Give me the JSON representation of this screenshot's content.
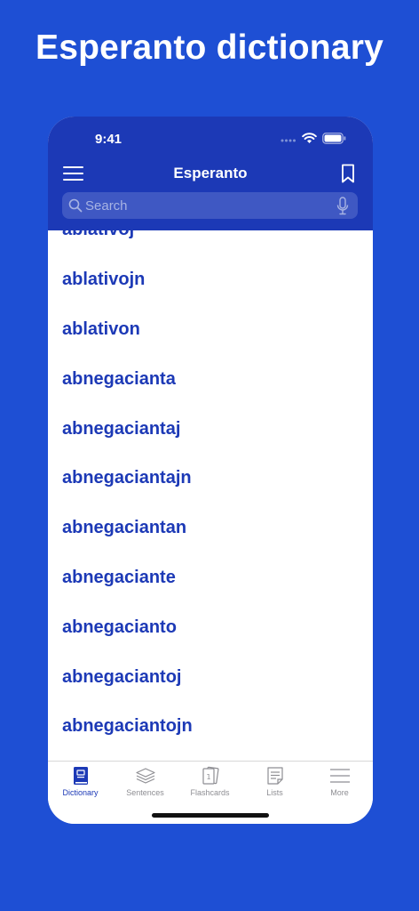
{
  "promo": {
    "title": "Esperanto dictionary"
  },
  "status_bar": {
    "time": "9:41"
  },
  "nav": {
    "title": "Esperanto"
  },
  "search": {
    "placeholder": "Search",
    "value": ""
  },
  "words": [
    "ablativoj",
    "ablativojn",
    "ablativon",
    "abnegacianta",
    "abnegaciantaj",
    "abnegaciantajn",
    "abnegaciantan",
    "abnegaciante",
    "abnegacianto",
    "abnegaciantoj",
    "abnegaciantojn"
  ],
  "tabs": [
    {
      "label": "Dictionary",
      "icon": "dictionary-icon",
      "active": true
    },
    {
      "label": "Sentences",
      "icon": "sentences-icon",
      "active": false
    },
    {
      "label": "Flashcards",
      "icon": "flashcards-icon",
      "active": false
    },
    {
      "label": "Lists",
      "icon": "lists-icon",
      "active": false
    },
    {
      "label": "More",
      "icon": "more-icon",
      "active": false
    }
  ],
  "colors": {
    "background": "#1e4fd4",
    "header": "#1c39b6",
    "accent": "#1c39b6",
    "inactive_tab": "#8e8e93"
  }
}
